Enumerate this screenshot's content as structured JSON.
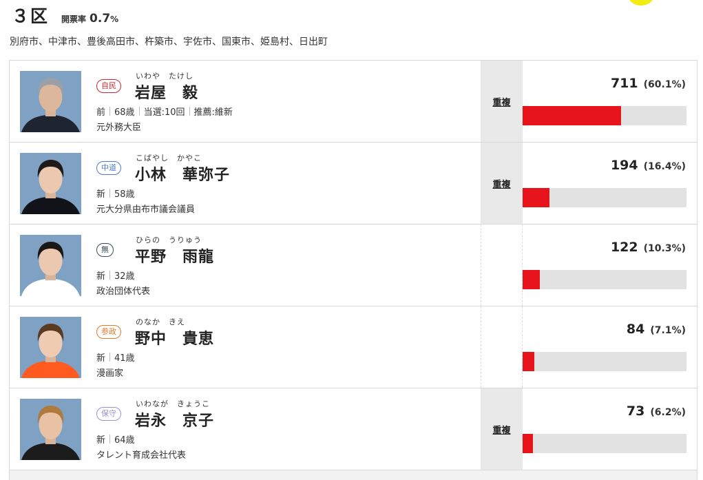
{
  "header": {
    "district": "３区",
    "count_label": "開票率",
    "count_value": "0.7",
    "count_unit": "%"
  },
  "area": "別府市、中津市、豊後高田市、杵築市、宇佐市、国東市、姫島村、日出町",
  "colors": {
    "bar_fill": "#e8141c",
    "bar_track": "#e2e2e2",
    "dup_shade": "#e9e9e9",
    "photo_bg": "#7ea1c4"
  },
  "candidates": [
    {
      "party": "自民",
      "party_color": "#c8282d",
      "furigana": "いわや　たけし",
      "name": "岩屋　毅",
      "meta": [
        "前",
        "68歳",
        "当選:10回",
        "推薦:維新"
      ],
      "career": "元外務大臣",
      "duplicate": "重複",
      "votes": "711",
      "percent": "(60.1%)",
      "share": 0.601
    },
    {
      "party": "中道",
      "party_color": "#4f78c8",
      "furigana": "こばやし　かやこ",
      "name": "小林　華弥子",
      "meta": [
        "新",
        "58歳"
      ],
      "career": "元大分県由布市議会議員",
      "duplicate": "重複",
      "votes": "194",
      "percent": "(16.4%)",
      "share": 0.164
    },
    {
      "party": "無",
      "party_color": "#3a4a5a",
      "furigana": "ひらの　うりゅう",
      "name": "平野　雨龍",
      "meta": [
        "新",
        "32歳"
      ],
      "career": "政治団体代表",
      "duplicate": "",
      "votes": "122",
      "percent": "(10.3%)",
      "share": 0.103
    },
    {
      "party": "参政",
      "party_color": "#e07a2a",
      "furigana": "のなか　きえ",
      "name": "野中　貴恵",
      "meta": [
        "新",
        "41歳"
      ],
      "career": "漫画家",
      "duplicate": "",
      "votes": "84",
      "percent": "(7.1%)",
      "share": 0.071
    },
    {
      "party": "保守",
      "party_color": "#9b8fd6",
      "furigana": "いわなが　きょうこ",
      "name": "岩永　京子",
      "meta": [
        "新",
        "64歳"
      ],
      "career": "タレント育成会社代表",
      "duplicate": "重複",
      "votes": "73",
      "percent": "(6.2%)",
      "share": 0.062
    }
  ]
}
